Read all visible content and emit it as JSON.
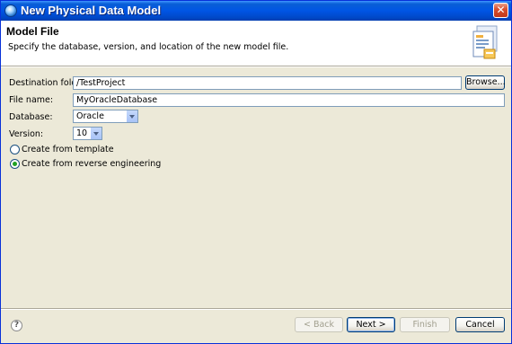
{
  "window": {
    "title": "New Physical Data Model",
    "close_glyph": "✕"
  },
  "header": {
    "title": "Model File",
    "description": "Specify the database, version, and location of the new model file.",
    "icon": "data-model-wizard-icon"
  },
  "form": {
    "destination_label": "Destination folder:",
    "destination_value": "/TestProject",
    "browse_label": "Browse...",
    "filename_label": "File name:",
    "filename_value": "MyOracleDatabase",
    "database_label": "Database:",
    "database_value": "Oracle",
    "version_label": "Version:",
    "version_value": "10",
    "radio_template_label": "Create from template",
    "radio_template_checked": false,
    "radio_reverse_label": "Create from reverse engineering",
    "radio_reverse_checked": true
  },
  "footer": {
    "help_glyph": "?",
    "back_label": "< Back",
    "next_label": "Next >",
    "finish_label": "Finish",
    "cancel_label": "Cancel"
  },
  "colors": {
    "titlebar": "#0055e5",
    "dialog_bg": "#ece9d8",
    "field_border": "#7f9db9",
    "radio_dot": "#21a121"
  }
}
